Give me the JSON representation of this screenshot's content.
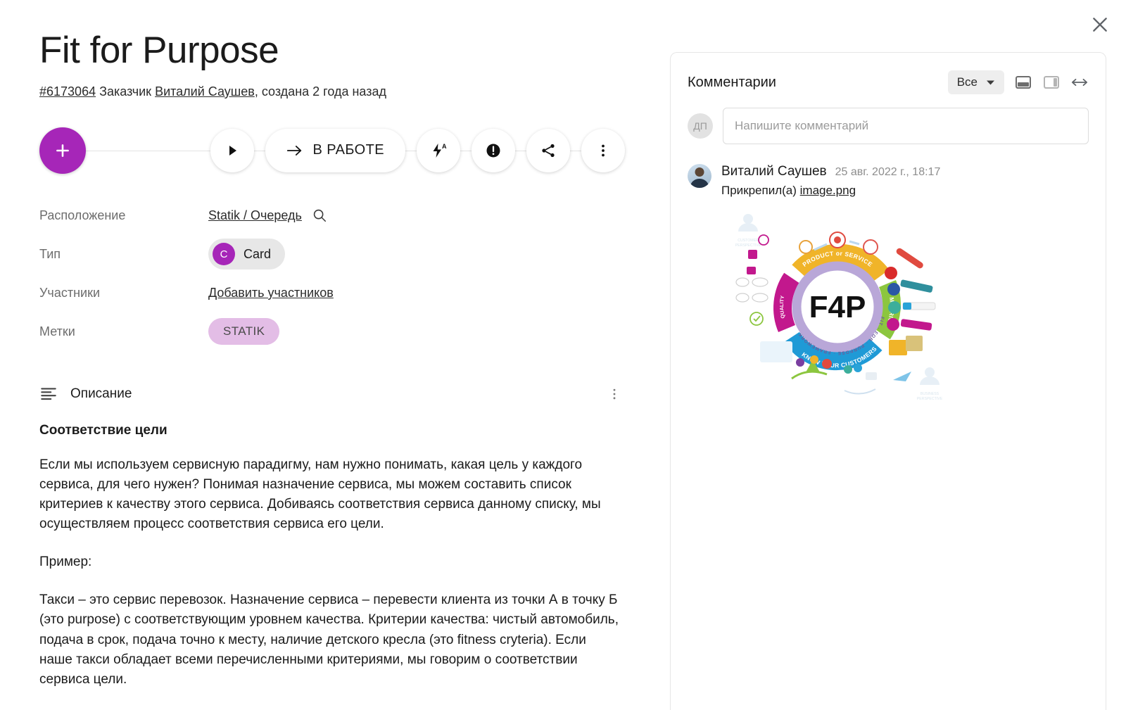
{
  "window": {
    "close_label": "close-icon"
  },
  "header": {
    "title": "Fit for Purpose",
    "id": "#6173064",
    "requester_label": "Заказчик",
    "requester_name": "Виталий Саушев",
    "created_text": ", создана 2 года назад"
  },
  "toolbar": {
    "add_label": "+",
    "play_label": "play-icon",
    "status_label": "В РАБОТЕ",
    "automation_label": "lightning-a-icon",
    "priority_label": "priority-icon",
    "share_label": "share-icon",
    "more_label": "more-icon"
  },
  "fields": [
    {
      "label": "Расположение",
      "value": "Statik / Очередь",
      "kind": "link"
    },
    {
      "label": "Тип",
      "value": "Card",
      "badge": "C",
      "kind": "pill"
    },
    {
      "label": "Участники",
      "value": "Добавить участников",
      "kind": "link"
    },
    {
      "label": "Метки",
      "value": "STATIK",
      "kind": "tag"
    }
  ],
  "description": {
    "section_title": "Описание",
    "subtitle": "Соответствие цели",
    "paragraphs": [
      "Если мы используем сервисную парадигму, нам нужно понимать, какая цель у каждого сервиса, для чего нужен? Понимая назначение сервиса, мы можем составить список критериев к качеству этого сервиса. Добиваясь соответствия сервиса данному списку, мы осуществляем процесс соответствия сервиса его цели.",
      "Пример:",
      "Такси – это сервис перевозок. Назначение сервиса – перевести клиента из точки А в точку Б (это purpose) с соответствующим уровнем качества. Критерии качества: чистый автомобиль, подача в срок, подача точно к месту, наличие детского кресла (это fitness cryteria). Если наше такси обладает всеми перечисленными критериями, мы говорим о соответствии сервиса цели."
    ]
  },
  "comments": {
    "title": "Комментарии",
    "filter_value": "Все",
    "compose_placeholder": "Напишите комментарий",
    "compose_avatar_initials": "ДП",
    "items": [
      {
        "author": "Виталий Саушев",
        "date": "25 авг. 2022 г., 18:17",
        "attach_prefix": "Прикрепил(а)",
        "attach_name": "image.png"
      }
    ]
  },
  "infographic": {
    "center": "F4P",
    "inner_ring": "FIT · FOR · PURPOSE · FRAMEWORK",
    "segments": [
      {
        "name": "PRODUCT or SERVICE",
        "subtitle": "FITNESS CRITERIA",
        "color": "#f0b429"
      },
      {
        "name": "METRICS",
        "color": "#8cc63f"
      },
      {
        "name": "KNOW YOUR CUSTOMERS",
        "color": "#1f7ec2"
      },
      {
        "name": "QUALITY",
        "color": "#c2188d"
      }
    ],
    "corner_labels": [
      "CUSTOMER PERSPECTIVE",
      "BUSINESS PERSPECTIVE"
    ]
  },
  "colors": {
    "accent_purple": "#a626b8",
    "tag_bg": "#e3bde6",
    "panel_border": "#e6e6e6"
  }
}
